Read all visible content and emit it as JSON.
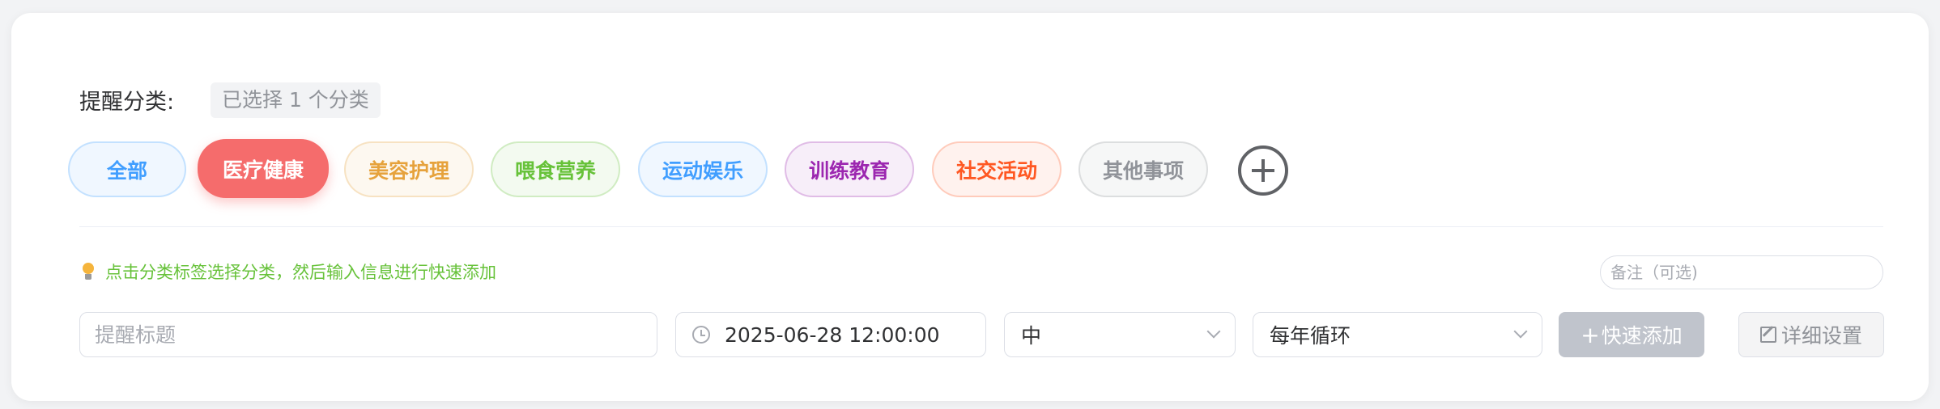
{
  "category_section": {
    "label": "提醒分类:",
    "selected_text": "已选择 1 个分类"
  },
  "categories": [
    {
      "label": "全部",
      "color": "#409eff",
      "active": false
    },
    {
      "label": "医疗健康",
      "color": "#f56c6c",
      "active": true
    },
    {
      "label": "美容护理",
      "color": "#e6a23c",
      "active": false
    },
    {
      "label": "喂食营养",
      "color": "#67c23a",
      "active": false
    },
    {
      "label": "运动娱乐",
      "color": "#409eff",
      "active": false
    },
    {
      "label": "训练教育",
      "color": "#9c27b0",
      "active": false
    },
    {
      "label": "社交活动",
      "color": "#ff5722",
      "active": false
    },
    {
      "label": "其他事项",
      "color": "#909399",
      "active": false
    }
  ],
  "add_category_icon": "plus-circle-icon",
  "tip": {
    "icon": "lightbulb-icon",
    "text": "点击分类标签选择分类，然后输入信息进行快速添加"
  },
  "note": {
    "placeholder": "备注（可选)",
    "value": ""
  },
  "form": {
    "title_placeholder": "提醒标题",
    "title_value": "",
    "datetime": "2025-06-28 12:00:00",
    "priority": "中",
    "repeat": "每年循环",
    "quick_add_label": "快速添加",
    "detail_label": "详细设置"
  }
}
